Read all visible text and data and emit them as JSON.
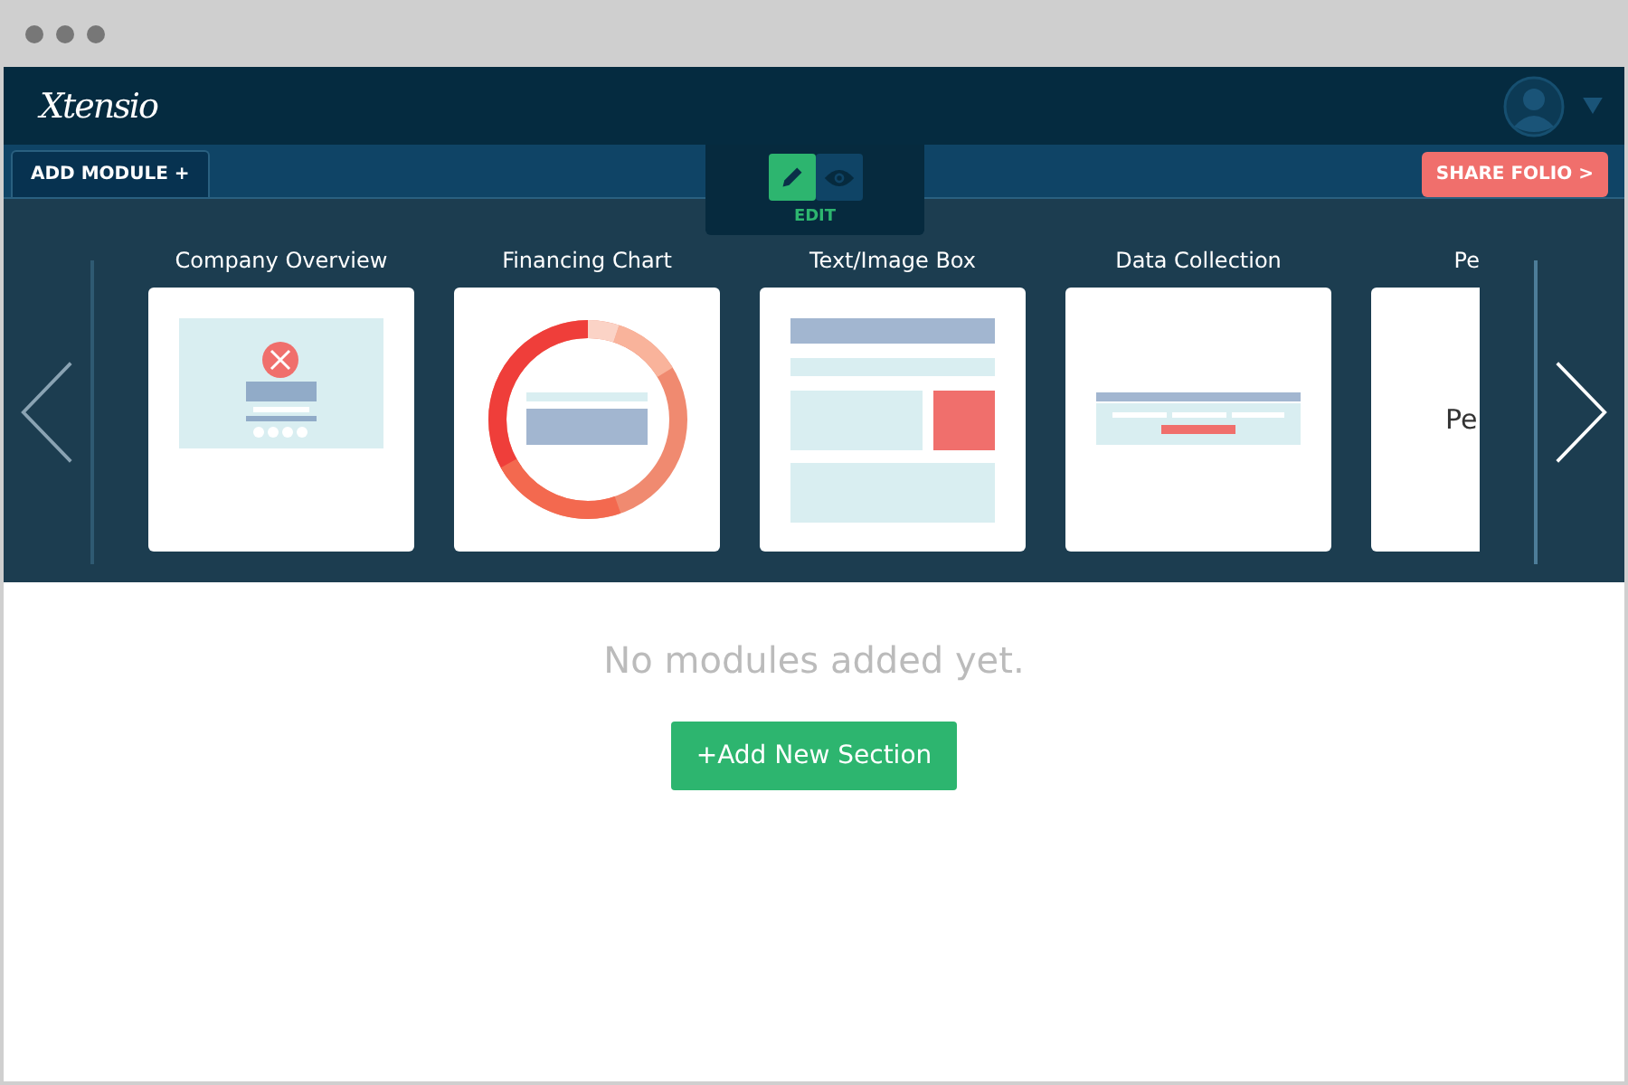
{
  "header": {
    "logo": "Xtensio"
  },
  "toolbar": {
    "add_tab": "ADD MODULE +",
    "modes": [
      {
        "kind": "edit",
        "selected": true
      },
      {
        "kind": "view",
        "selected": false
      }
    ],
    "mode_label": "EDIT",
    "share_button": "SHARE FOLIO >"
  },
  "modules": [
    {
      "title": "Company Overview",
      "kind": "overview"
    },
    {
      "title": "Financing Chart",
      "kind": "chart"
    },
    {
      "title": "Text/Image Box",
      "kind": "textimage"
    },
    {
      "title": "Data Collection",
      "kind": "data"
    },
    {
      "title": "Pe",
      "kind": "partial",
      "preview_text": "Pe"
    }
  ],
  "empty_state": {
    "message": "No modules added yet.",
    "button": "+Add New Section"
  }
}
